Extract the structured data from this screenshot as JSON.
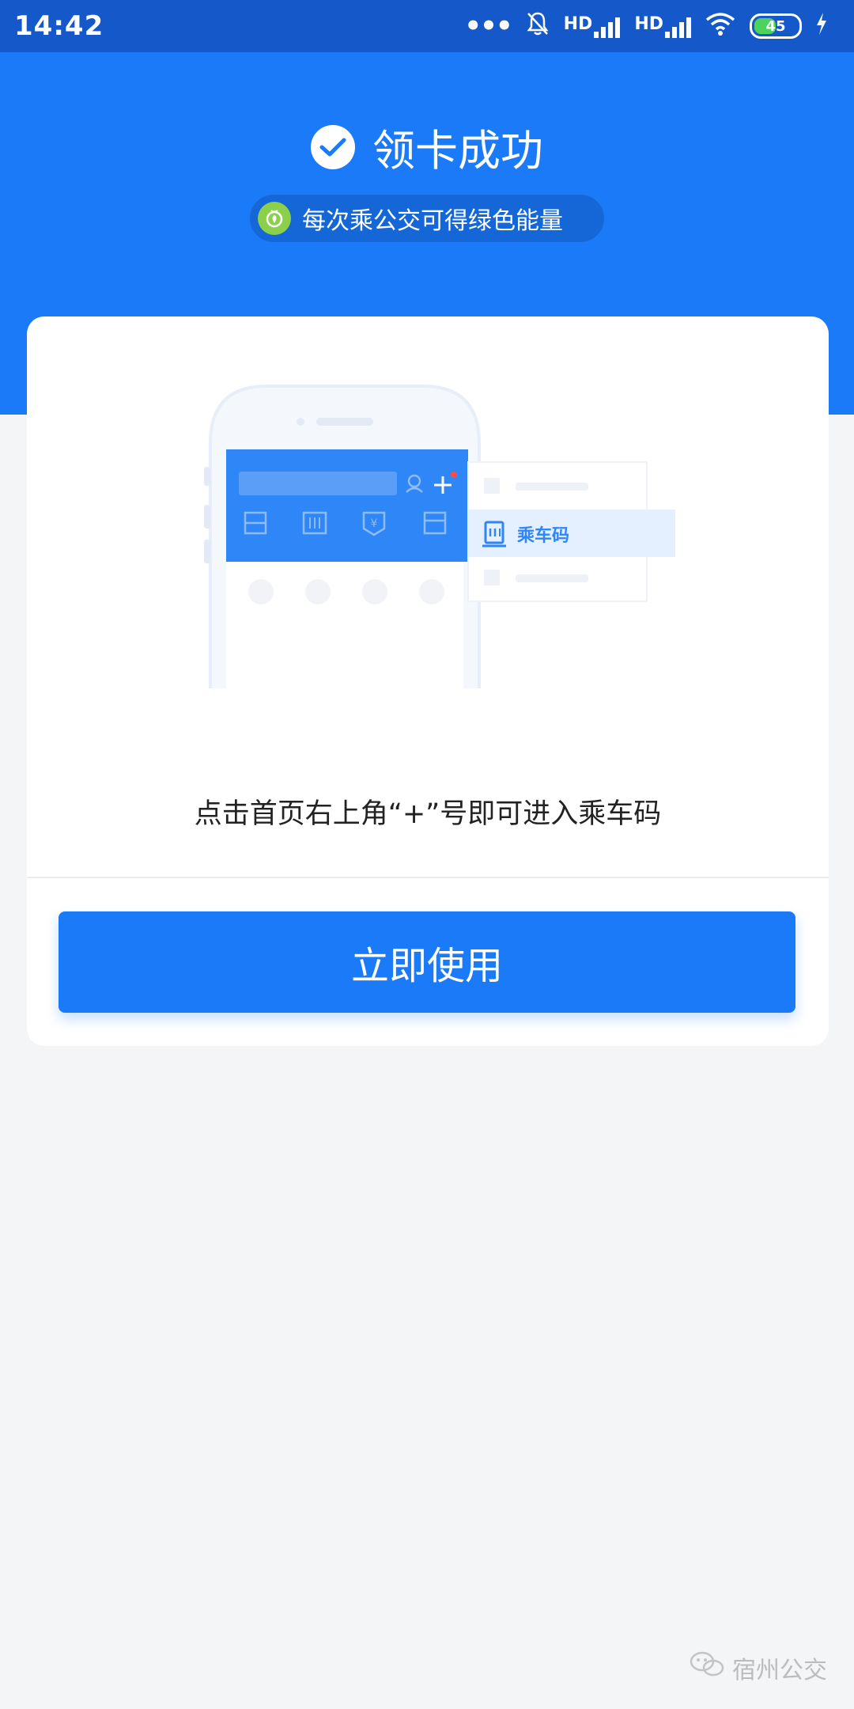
{
  "status_bar": {
    "time": "14:42",
    "network_label_1": "HD",
    "network_label_2": "HD",
    "battery_level": "45"
  },
  "header": {
    "title": "领卡成功",
    "subtitle_pill": "每次乘公交可得绿色能量"
  },
  "illustration": {
    "menu_item_label": "乘车码"
  },
  "card": {
    "hint_text": "点击首页右上角“+”号即可进入乘车码",
    "button_label": "立即使用"
  },
  "watermark": {
    "text": "宿州公交"
  },
  "colors": {
    "brand_blue": "#1a7af8",
    "status_bar_blue": "#1558c9",
    "energy_green": "#8bd04b",
    "page_background": "#f4f5f7"
  }
}
